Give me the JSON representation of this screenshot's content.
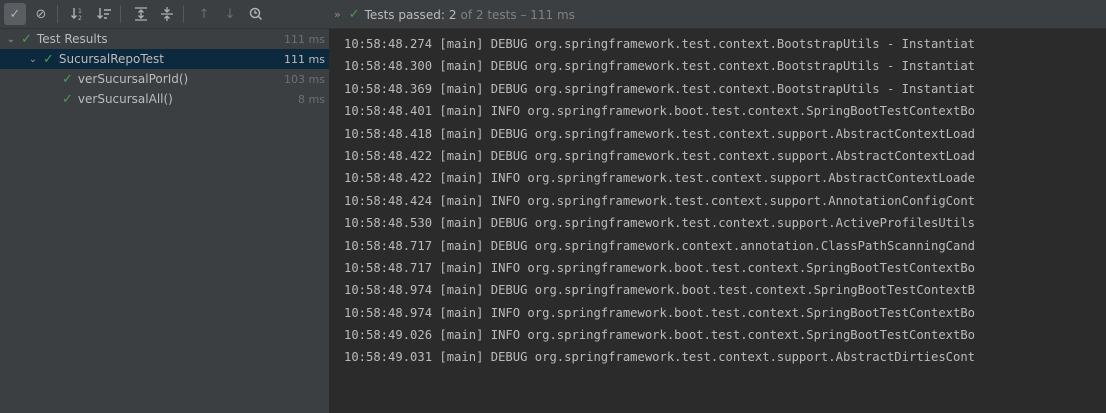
{
  "toolbar": {
    "buttons": [
      {
        "name": "show-passed-button",
        "icon": "check-icon",
        "glyph": "✓"
      },
      {
        "name": "show-ignored-button",
        "icon": "circle-slash-icon",
        "glyph": "⊘"
      },
      {
        "name": "sort-alphabetically-button",
        "icon": "sort-alpha-icon",
        "glyph": "↓ᵃ"
      },
      {
        "name": "sort-by-duration-button",
        "icon": "sort-duration-icon",
        "glyph": "↓≡"
      },
      {
        "name": "expand-all-button",
        "icon": "expand-all-icon",
        "glyph": "⇕"
      },
      {
        "name": "collapse-all-button",
        "icon": "collapse-all-icon",
        "glyph": "÷"
      },
      {
        "name": "previous-failed-button",
        "icon": "arrow-up-icon",
        "glyph": "↑"
      },
      {
        "name": "next-failed-button",
        "icon": "arrow-down-icon",
        "glyph": "↓"
      },
      {
        "name": "search-button",
        "icon": "search-icon",
        "glyph": "Q"
      }
    ]
  },
  "status": {
    "label": "Tests passed:",
    "passed": "2",
    "of_total": "of 2 tests – 111 ms"
  },
  "tree": {
    "rows": [
      {
        "name": "Test Results",
        "time": "111 ms",
        "level": 0,
        "expanded": true,
        "selected": false
      },
      {
        "name": "SucursalRepoTest",
        "time": "111 ms",
        "level": 1,
        "expanded": true,
        "selected": true
      },
      {
        "name": "verSucursalPorId()",
        "time": "103 ms",
        "level": 2,
        "expanded": null,
        "selected": false
      },
      {
        "name": "verSucursalAll()",
        "time": "8 ms",
        "level": 2,
        "expanded": null,
        "selected": false
      }
    ]
  },
  "console": {
    "lines": [
      "10:58:48.274 [main] DEBUG org.springframework.test.context.BootstrapUtils - Instantiat",
      "10:58:48.300 [main] DEBUG org.springframework.test.context.BootstrapUtils - Instantiat",
      "10:58:48.369 [main] DEBUG org.springframework.test.context.BootstrapUtils - Instantiat",
      "10:58:48.401 [main] INFO org.springframework.boot.test.context.SpringBootTestContextBo",
      "10:58:48.418 [main] DEBUG org.springframework.test.context.support.AbstractContextLoad",
      "10:58:48.422 [main] DEBUG org.springframework.test.context.support.AbstractContextLoad",
      "10:58:48.422 [main] INFO org.springframework.test.context.support.AbstractContextLoade",
      "10:58:48.424 [main] INFO org.springframework.test.context.support.AnnotationConfigCont",
      "10:58:48.530 [main] DEBUG org.springframework.test.context.support.ActiveProfilesUtils",
      "10:58:48.717 [main] DEBUG org.springframework.context.annotation.ClassPathScanningCand",
      "10:58:48.717 [main] INFO org.springframework.boot.test.context.SpringBootTestContextBo",
      "10:58:48.974 [main] DEBUG org.springframework.boot.test.context.SpringBootTestContextB",
      "10:58:48.974 [main] INFO org.springframework.boot.test.context.SpringBootTestContextBo",
      "10:58:49.026 [main] INFO org.springframework.boot.test.context.SpringBootTestContextBo",
      "10:58:49.031 [main] DEBUG org.springframework.test.context.support.AbstractDirtiesCont"
    ]
  },
  "colors": {
    "pass_green": "#499c54",
    "panel_bg": "#3c3f41",
    "console_bg": "#2b2b2b",
    "selection": "#0d293e"
  }
}
